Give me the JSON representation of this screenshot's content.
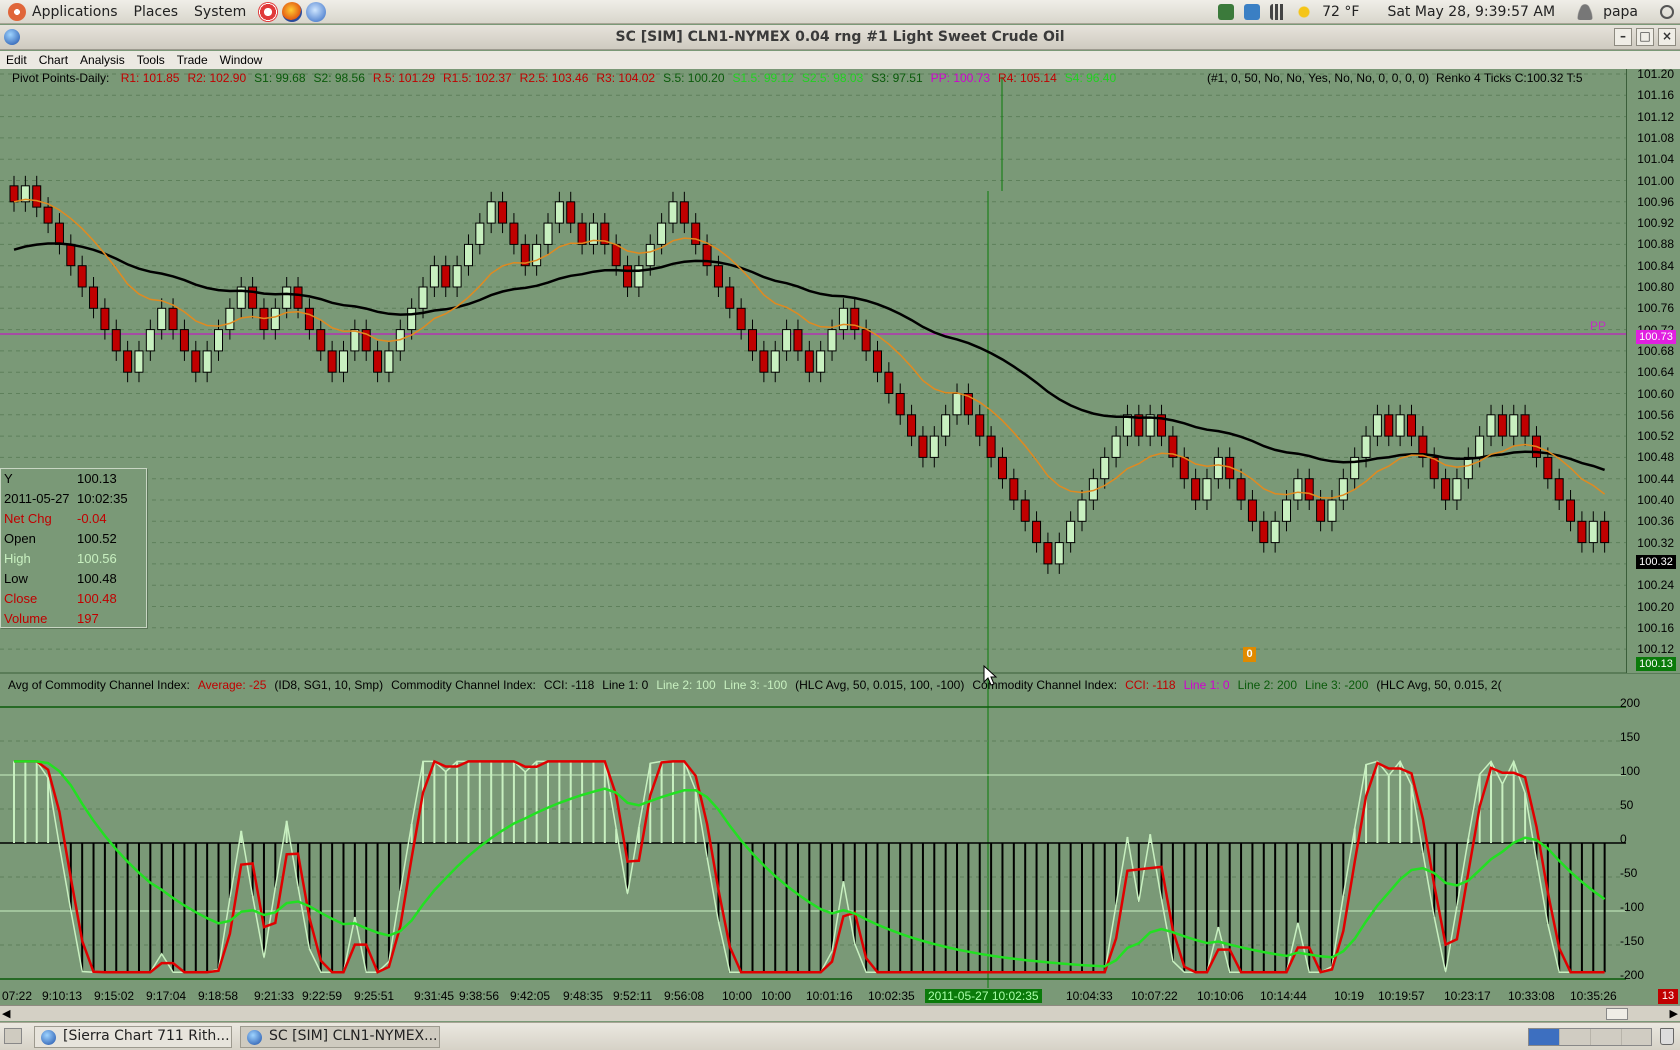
{
  "panel": {
    "menus": [
      "Applications",
      "Places",
      "System"
    ],
    "temperature": "72 °F",
    "datetime": "Sat May 28,  9:39:57 AM",
    "user": "papa"
  },
  "window": {
    "title": "SC [SIM] CLN1-NYMEX  0.04 rng  #1  Light Sweet Crude Oil",
    "buttons": [
      "–",
      "□",
      "×"
    ]
  },
  "menubar": [
    "Edit",
    "Chart",
    "Analysis",
    "Tools",
    "Trade",
    "Window"
  ],
  "main_chart": {
    "study_label": "Pivot Points-Daily:",
    "pivots": [
      {
        "t": "R1: 101.85",
        "c": "#c00000"
      },
      {
        "t": "R2: 102.90",
        "c": "#c00000"
      },
      {
        "t": "S1: 99.68",
        "c": "#0a5a0a"
      },
      {
        "t": "S2: 98.56",
        "c": "#0a5a0a"
      },
      {
        "t": "R.5: 101.29",
        "c": "#c00000"
      },
      {
        "t": "R1.5: 102.37",
        "c": "#c00000"
      },
      {
        "t": "R2.5: 103.46",
        "c": "#c00000"
      },
      {
        "t": "R3: 104.02",
        "c": "#c00000"
      },
      {
        "t": "S.5: 100.20",
        "c": "#0a5a0a"
      },
      {
        "t": "S1.5: 99.12",
        "c": "#22d022"
      },
      {
        "t": "S2.5: 98.03",
        "c": "#22d022"
      },
      {
        "t": "S3: 97.51",
        "c": "#0a5a0a"
      },
      {
        "t": "PP: 100.73",
        "c": "#d000d0"
      },
      {
        "t": "R4: 105.14",
        "c": "#c00000"
      },
      {
        "t": "S4: 96.40",
        "c": "#22d022"
      }
    ],
    "params": "(#1, 0, 50, No, No, Yes, No, No, 0, 0, 0, 0)",
    "right_label": "Renko 4 Ticks C:100.32 T:5",
    "pp_label": "PP",
    "pp_tag": "100.73",
    "close_tag": "100.32",
    "cursor_tag": "100.13",
    "marker": "0",
    "y_ticks": [
      "101.20",
      "101.16",
      "101.12",
      "101.08",
      "101.04",
      "101.00",
      "100.96",
      "100.92",
      "100.88",
      "100.84",
      "100.80",
      "100.76",
      "100.72",
      "100.68",
      "100.64",
      "100.60",
      "100.56",
      "100.52",
      "100.48",
      "100.44",
      "100.40",
      "100.36",
      "100.32",
      "100.28",
      "100.24",
      "100.20",
      "100.16",
      "100.12"
    ]
  },
  "data_window": {
    "rows": [
      {
        "label": "Y",
        "value": "100.13",
        "lc": "#000",
        "vc": "#000"
      },
      {
        "label": " 2011-05-27",
        "value": "10:02:35",
        "lc": "#000",
        "vc": "#000"
      },
      {
        "label": "Net Chg",
        "value": "-0.04",
        "lc": "#c00000",
        "vc": "#c00000"
      },
      {
        "label": "Open",
        "value": "100.52",
        "lc": "#000",
        "vc": "#000"
      },
      {
        "label": "High",
        "value": "100.56",
        "lc": "#c8f0c0",
        "vc": "#c8f0c0"
      },
      {
        "label": "Low",
        "value": "100.48",
        "lc": "#000",
        "vc": "#000"
      },
      {
        "label": "Close",
        "value": "100.48",
        "lc": "#c00000",
        "vc": "#c00000"
      },
      {
        "label": "Volume",
        "value": "197",
        "lc": "#c00000",
        "vc": "#c00000"
      }
    ]
  },
  "cci_panel": {
    "parts": [
      {
        "t": "Avg of Commodity Channel Index:",
        "c": "#000"
      },
      {
        "t": "Average: -25",
        "c": "#c00000"
      },
      {
        "t": "(ID8, SG1, 10, Smp)",
        "c": "#000"
      },
      {
        "t": "Commodity Channel Index:",
        "c": "#000"
      },
      {
        "t": "CCI: -118",
        "c": "#000"
      },
      {
        "t": "Line 1: 0",
        "c": "#000"
      },
      {
        "t": "Line 2: 100",
        "c": "#c8f0c0"
      },
      {
        "t": "Line 3: -100",
        "c": "#c8f0c0"
      },
      {
        "t": "(HLC Avg, 50, 0.015, 100, -100)",
        "c": "#000"
      },
      {
        "t": "Commodity Channel Index:",
        "c": "#000"
      },
      {
        "t": "CCI: -118",
        "c": "#c00000"
      },
      {
        "t": "Line 1: 0",
        "c": "#d000d0"
      },
      {
        "t": "Line 2: 200",
        "c": "#0a5a0a"
      },
      {
        "t": "Line 3: -200",
        "c": "#0a5a0a"
      },
      {
        "t": "(HLC Avg, 50, 0.015, 2(",
        "c": "#000"
      }
    ],
    "y_ticks": [
      "200",
      "150",
      "100",
      "50",
      "0",
      "-50",
      "-100",
      "-150",
      "-200"
    ]
  },
  "x_axis": {
    "labels": [
      "07:22",
      "9:10:13",
      "9:15:02",
      "9:17:04",
      "9:18:58",
      "9:21:33",
      "9:22:59",
      "9:25:51",
      "9:31:45",
      "9:38:56",
      "9:42:05",
      "9:48:35",
      "9:52:11",
      "9:56:08",
      "10:00",
      "10:00",
      "10:01:16",
      "10:02:35",
      "2011-05-27  10:02:35",
      "10:04:33",
      "10:07:22",
      "10:10:06",
      "10:14:44",
      "10:19",
      "10:19:57",
      "10:23:17",
      "10:33:08",
      "10:35:26"
    ],
    "corner": "13"
  },
  "taskbar": [
    {
      "label": "[Sierra Chart 711 Rith...",
      "active": false
    },
    {
      "label": "SC [SIM] CLN1-NYMEX...",
      "active": true
    }
  ]
}
